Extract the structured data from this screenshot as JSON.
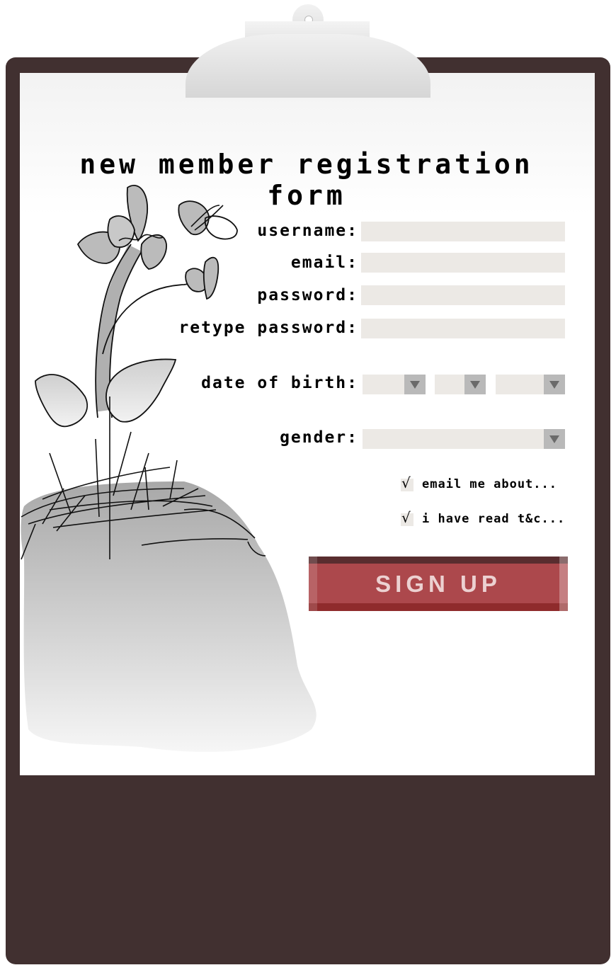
{
  "form": {
    "title": "new member registration form",
    "fields": {
      "username_label": "username:",
      "email_label": "email:",
      "password_label": "password:",
      "retype_password_label": "retype password:",
      "dob_label": "date of birth:",
      "gender_label": "gender:"
    },
    "checkboxes": [
      {
        "label": "email me about...",
        "checked": true
      },
      {
        "label": "I have read T&C...",
        "checked": true
      }
    ],
    "checkmark": "√",
    "signup_label": "SIGN UP"
  },
  "colors": {
    "board": "#413030",
    "field_bg": "#ece9e5",
    "button": "#ac484c",
    "button_text": "#ecd1d1"
  },
  "icons": [
    "clipboard-clip-icon",
    "dropdown-arrow-icon",
    "checkmark-icon"
  ]
}
